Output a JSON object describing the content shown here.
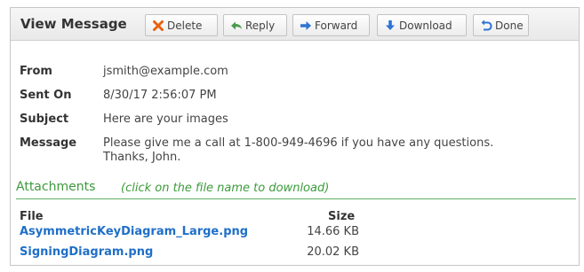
{
  "window": {
    "title": "View Message"
  },
  "toolbar": {
    "delete_label": "Delete",
    "reply_label": "Reply",
    "forward_label": "Forward",
    "download_label": "Download",
    "done_label": "Done"
  },
  "icons": {
    "delete": "x-icon",
    "reply": "reply-arrow-icon",
    "forward": "forward-arrow-icon",
    "download": "down-arrow-icon",
    "done": "undo-arrow-icon"
  },
  "colors": {
    "delete_icon": "#e8620e",
    "reply_icon": "#4a9a4a",
    "arrow_icon": "#2d74d3",
    "link": "#1f6fc7",
    "section": "#3c9a3c"
  },
  "message": {
    "from_label": "From",
    "from": "jsmith@example.com",
    "sent_label": "Sent On",
    "sent": "8/30/17 2:56:07 PM",
    "subject_label": "Subject",
    "subject": "Here are your images",
    "message_label": "Message",
    "body_line1": "Please give me a call at 1-800-949-4696 if you have any questions.",
    "body_line2": "Thanks, John."
  },
  "attachments": {
    "title": "Attachments",
    "hint": "(click on the file name to download)",
    "col_file": "File",
    "col_size": "Size",
    "files": [
      {
        "name": "AsymmetricKeyDiagram_Large.png",
        "size": "14.66 KB"
      },
      {
        "name": "SigningDiagram.png",
        "size": "20.02 KB"
      }
    ]
  }
}
